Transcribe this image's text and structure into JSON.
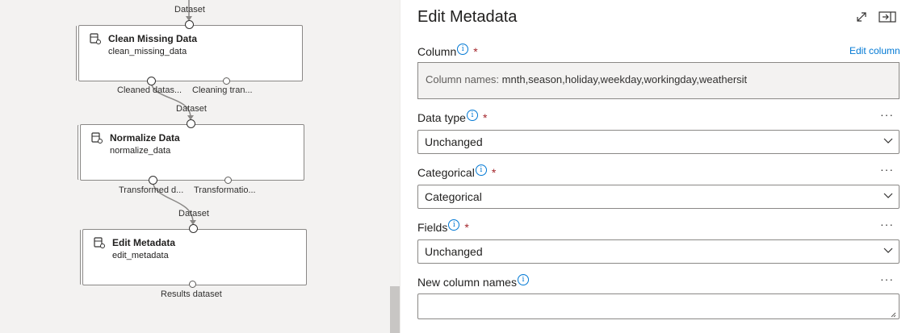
{
  "canvas": {
    "modules": [
      {
        "title": "Clean Missing Data",
        "subtitle": "clean_missing_data",
        "input_label": "Dataset",
        "output_labels": [
          "Cleaned datas...",
          "Cleaning tran..."
        ]
      },
      {
        "title": "Normalize Data",
        "subtitle": "normalize_data",
        "input_label": "Dataset",
        "output_labels": [
          "Transformed d...",
          "Transformatio..."
        ]
      },
      {
        "title": "Edit Metadata",
        "subtitle": "edit_metadata",
        "input_label": "Dataset",
        "output_labels": [
          "Results dataset"
        ]
      }
    ]
  },
  "panel": {
    "title": "Edit Metadata",
    "expand_icon": "expand-icon",
    "collapse_icon": "collapse-panel-icon",
    "column": {
      "label": "Column",
      "required_mark": "*",
      "edit_link": "Edit column",
      "prefix": "Column names:",
      "value": "mnth,season,holiday,weekday,workingday,weathersit"
    },
    "data_type": {
      "label": "Data type",
      "required_mark": "*",
      "value": "Unchanged"
    },
    "categorical": {
      "label": "Categorical",
      "required_mark": "*",
      "value": "Categorical"
    },
    "fields": {
      "label": "Fields",
      "required_mark": "*",
      "value": "Unchanged"
    },
    "new_column_names": {
      "label": "New column names",
      "value": ""
    },
    "more_label": "···",
    "info_glyph": "i"
  },
  "colors": {
    "accent": "#0078d4",
    "required": "#a4262c",
    "canvas_bg": "#f3f2f1",
    "border": "#8a8886"
  }
}
